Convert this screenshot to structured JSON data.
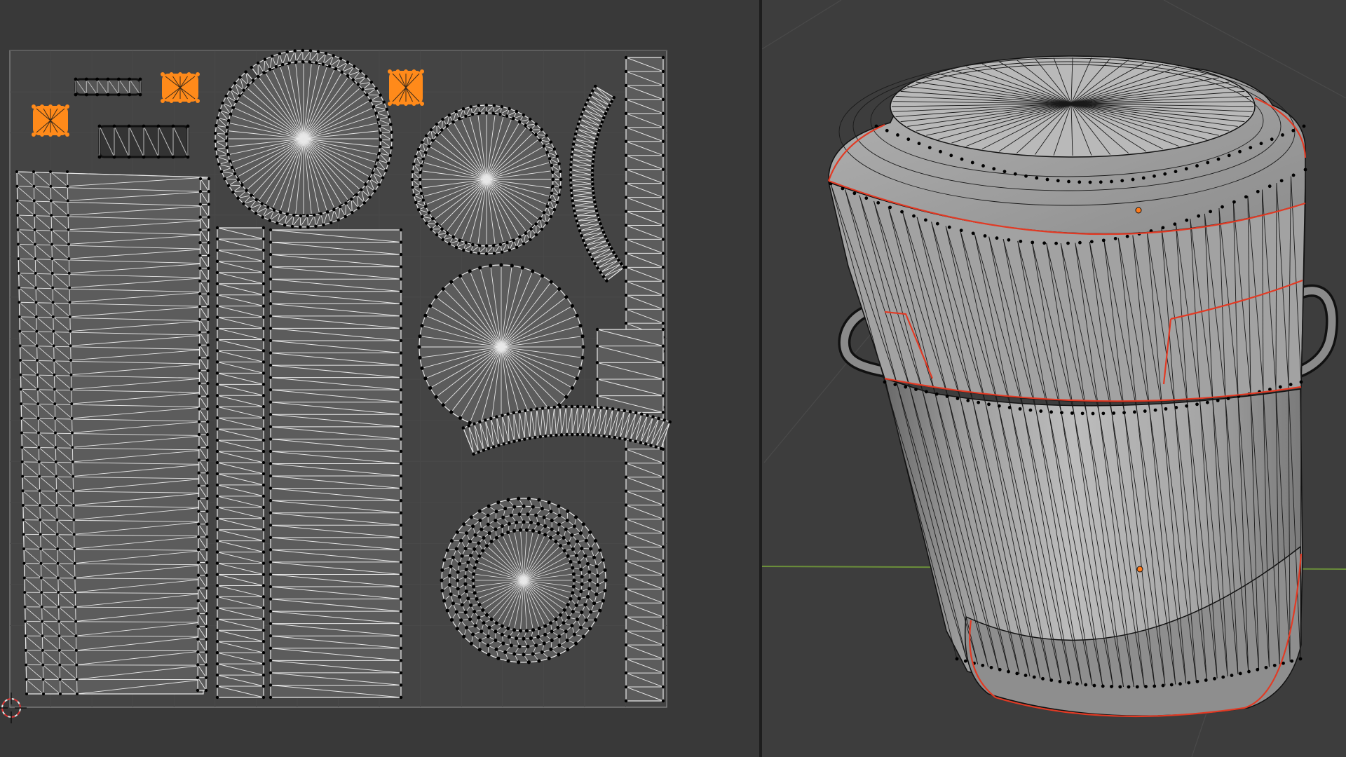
{
  "colors": {
    "uv_background": "#393939",
    "uv_tile": "#444444",
    "uv_grid": "#4a4a4a",
    "uv_border": "#8a8a8a",
    "face_fill": "#5c5c5c",
    "uv_edge": "#e8e8e8",
    "vertex": "#000000",
    "selected_island": "#ff8a1a",
    "viewport_background": "#3d3d3d",
    "mesh_face": "#9a9a9a",
    "mesh_edge": "#1a1a1a",
    "seam": "#e23a24",
    "x_axis": "#6b8f3a",
    "origin": "#ff7a1a"
  },
  "uv_editor": {
    "islands": [
      "rim-strip-left",
      "body-strip",
      "side-strip-a",
      "side-strip-b",
      "strip-right",
      "disc-lid",
      "disc-top",
      "disc-bottom",
      "disc-base",
      "arc-handle",
      "arc-lower",
      "block-right",
      "handle-pieces"
    ],
    "selected_islands": 3,
    "cursor": "2d-cursor-icon"
  },
  "viewport_3d": {
    "object": "trash-can-mesh",
    "mode": "edit",
    "seams_visible": true,
    "origin_marker": "origin-icon"
  }
}
